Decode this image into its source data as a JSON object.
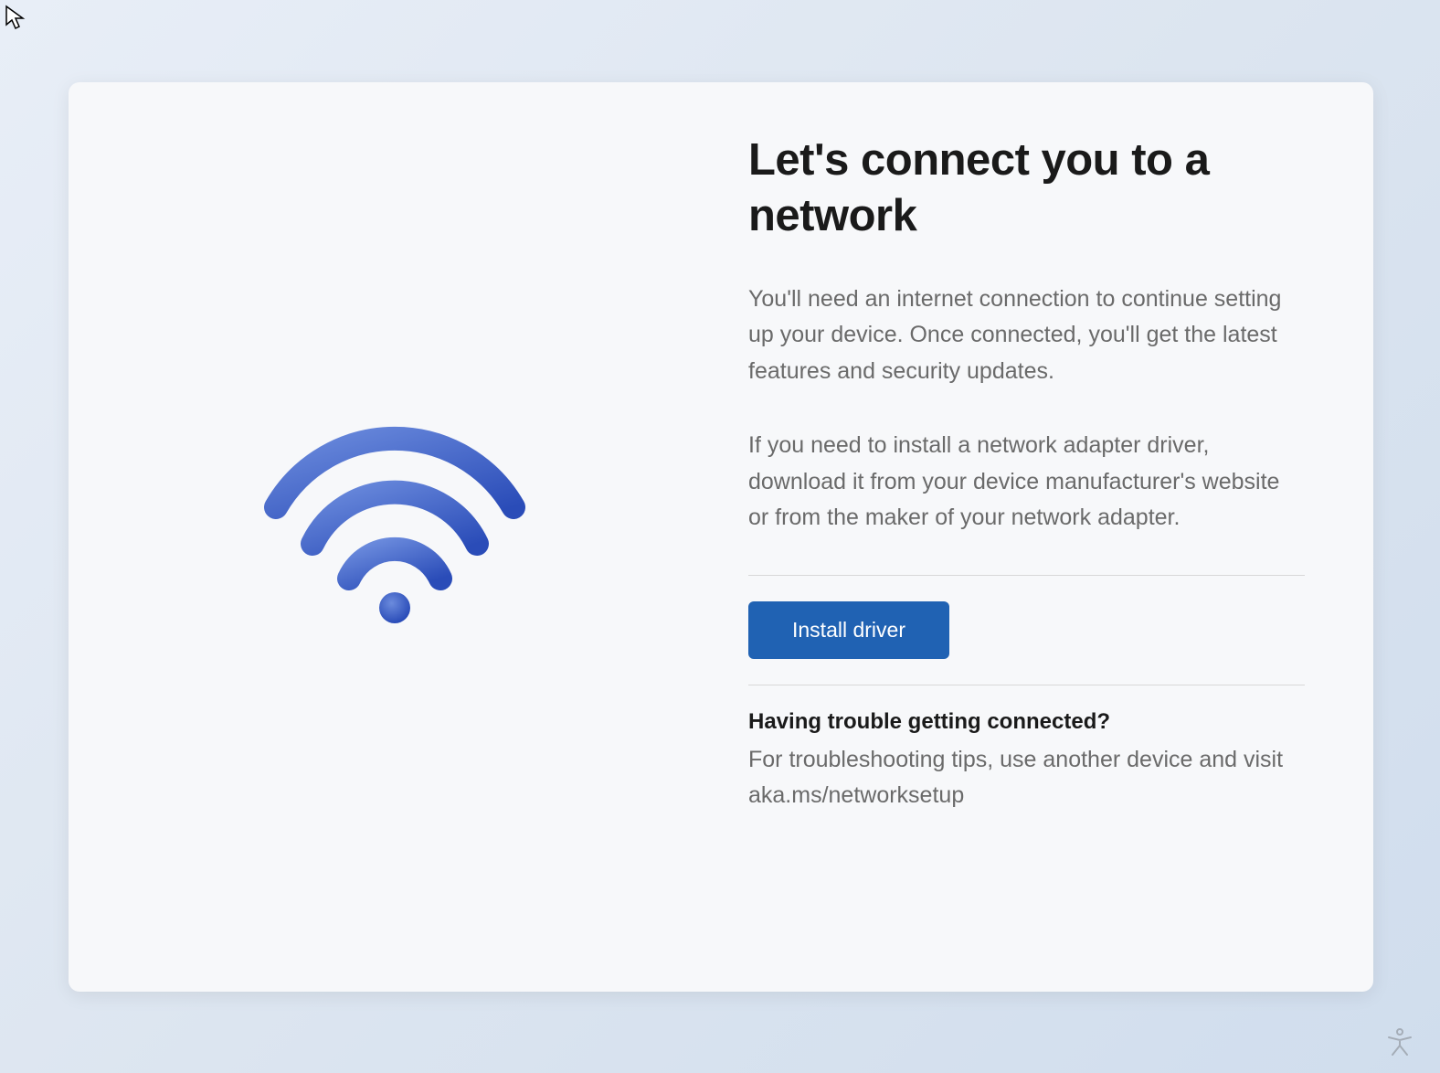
{
  "title": "Let's connect you to a network",
  "description1": "You'll need an internet connection to continue setting up your device. Once connected, you'll get the latest features and security updates.",
  "description2": "If you need to install a network adapter driver, download it from your device manufacturer's website or from the maker of your network adapter.",
  "install_button_label": "Install driver",
  "trouble": {
    "heading": "Having trouble getting connected?",
    "text": "For troubleshooting tips, use another device and visit aka.ms/networksetup"
  },
  "icons": {
    "wifi": "wifi-icon",
    "accessibility": "accessibility-icon",
    "cursor": "cursor-icon"
  },
  "colors": {
    "accent": "#2062b3",
    "wifi_gradient_start": "#5b7bd5",
    "wifi_gradient_end": "#2a4cb8"
  }
}
